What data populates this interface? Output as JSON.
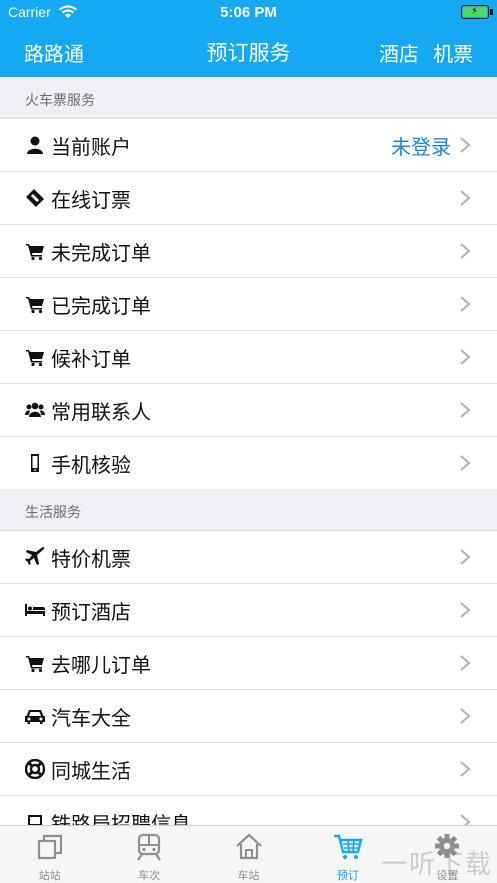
{
  "status": {
    "carrier": "Carrier",
    "time": "5:06 PM"
  },
  "nav": {
    "left": "路路通",
    "title": "预订服务",
    "right": [
      "酒店",
      "机票"
    ]
  },
  "sections": [
    {
      "header": "火车票服务",
      "rows": [
        {
          "icon": "user-icon",
          "label": "当前账户",
          "value": "未登录"
        },
        {
          "icon": "ticket-icon",
          "label": "在线订票"
        },
        {
          "icon": "cart-icon",
          "label": "未完成订单"
        },
        {
          "icon": "cart-icon",
          "label": "已完成订单"
        },
        {
          "icon": "cart-icon",
          "label": "候补订单"
        },
        {
          "icon": "users-icon",
          "label": "常用联系人"
        },
        {
          "icon": "mobile-icon",
          "label": "手机核验"
        }
      ]
    },
    {
      "header": "生活服务",
      "rows": [
        {
          "icon": "plane-icon",
          "label": "特价机票"
        },
        {
          "icon": "bed-icon",
          "label": "预订酒店"
        },
        {
          "icon": "cart-icon",
          "label": "去哪儿订单"
        },
        {
          "icon": "car-icon",
          "label": "汽车大全"
        },
        {
          "icon": "lifebuoy-icon",
          "label": "同城生活"
        },
        {
          "icon": "laptop-icon",
          "label": "铁路局招聘信息"
        }
      ]
    }
  ],
  "tabs": [
    {
      "label": "站站",
      "icon": "stations-icon",
      "active": false
    },
    {
      "label": "车次",
      "icon": "train-icon",
      "active": false
    },
    {
      "label": "车站",
      "icon": "home-icon",
      "active": false
    },
    {
      "label": "预订",
      "icon": "cart-icon",
      "active": true
    },
    {
      "label": "设置",
      "icon": "gear-icon",
      "active": false
    }
  ],
  "watermark": "一听下载",
  "colors": {
    "accent": "#16a9f3",
    "link": "#1a86d8",
    "background": "#efeff4"
  }
}
